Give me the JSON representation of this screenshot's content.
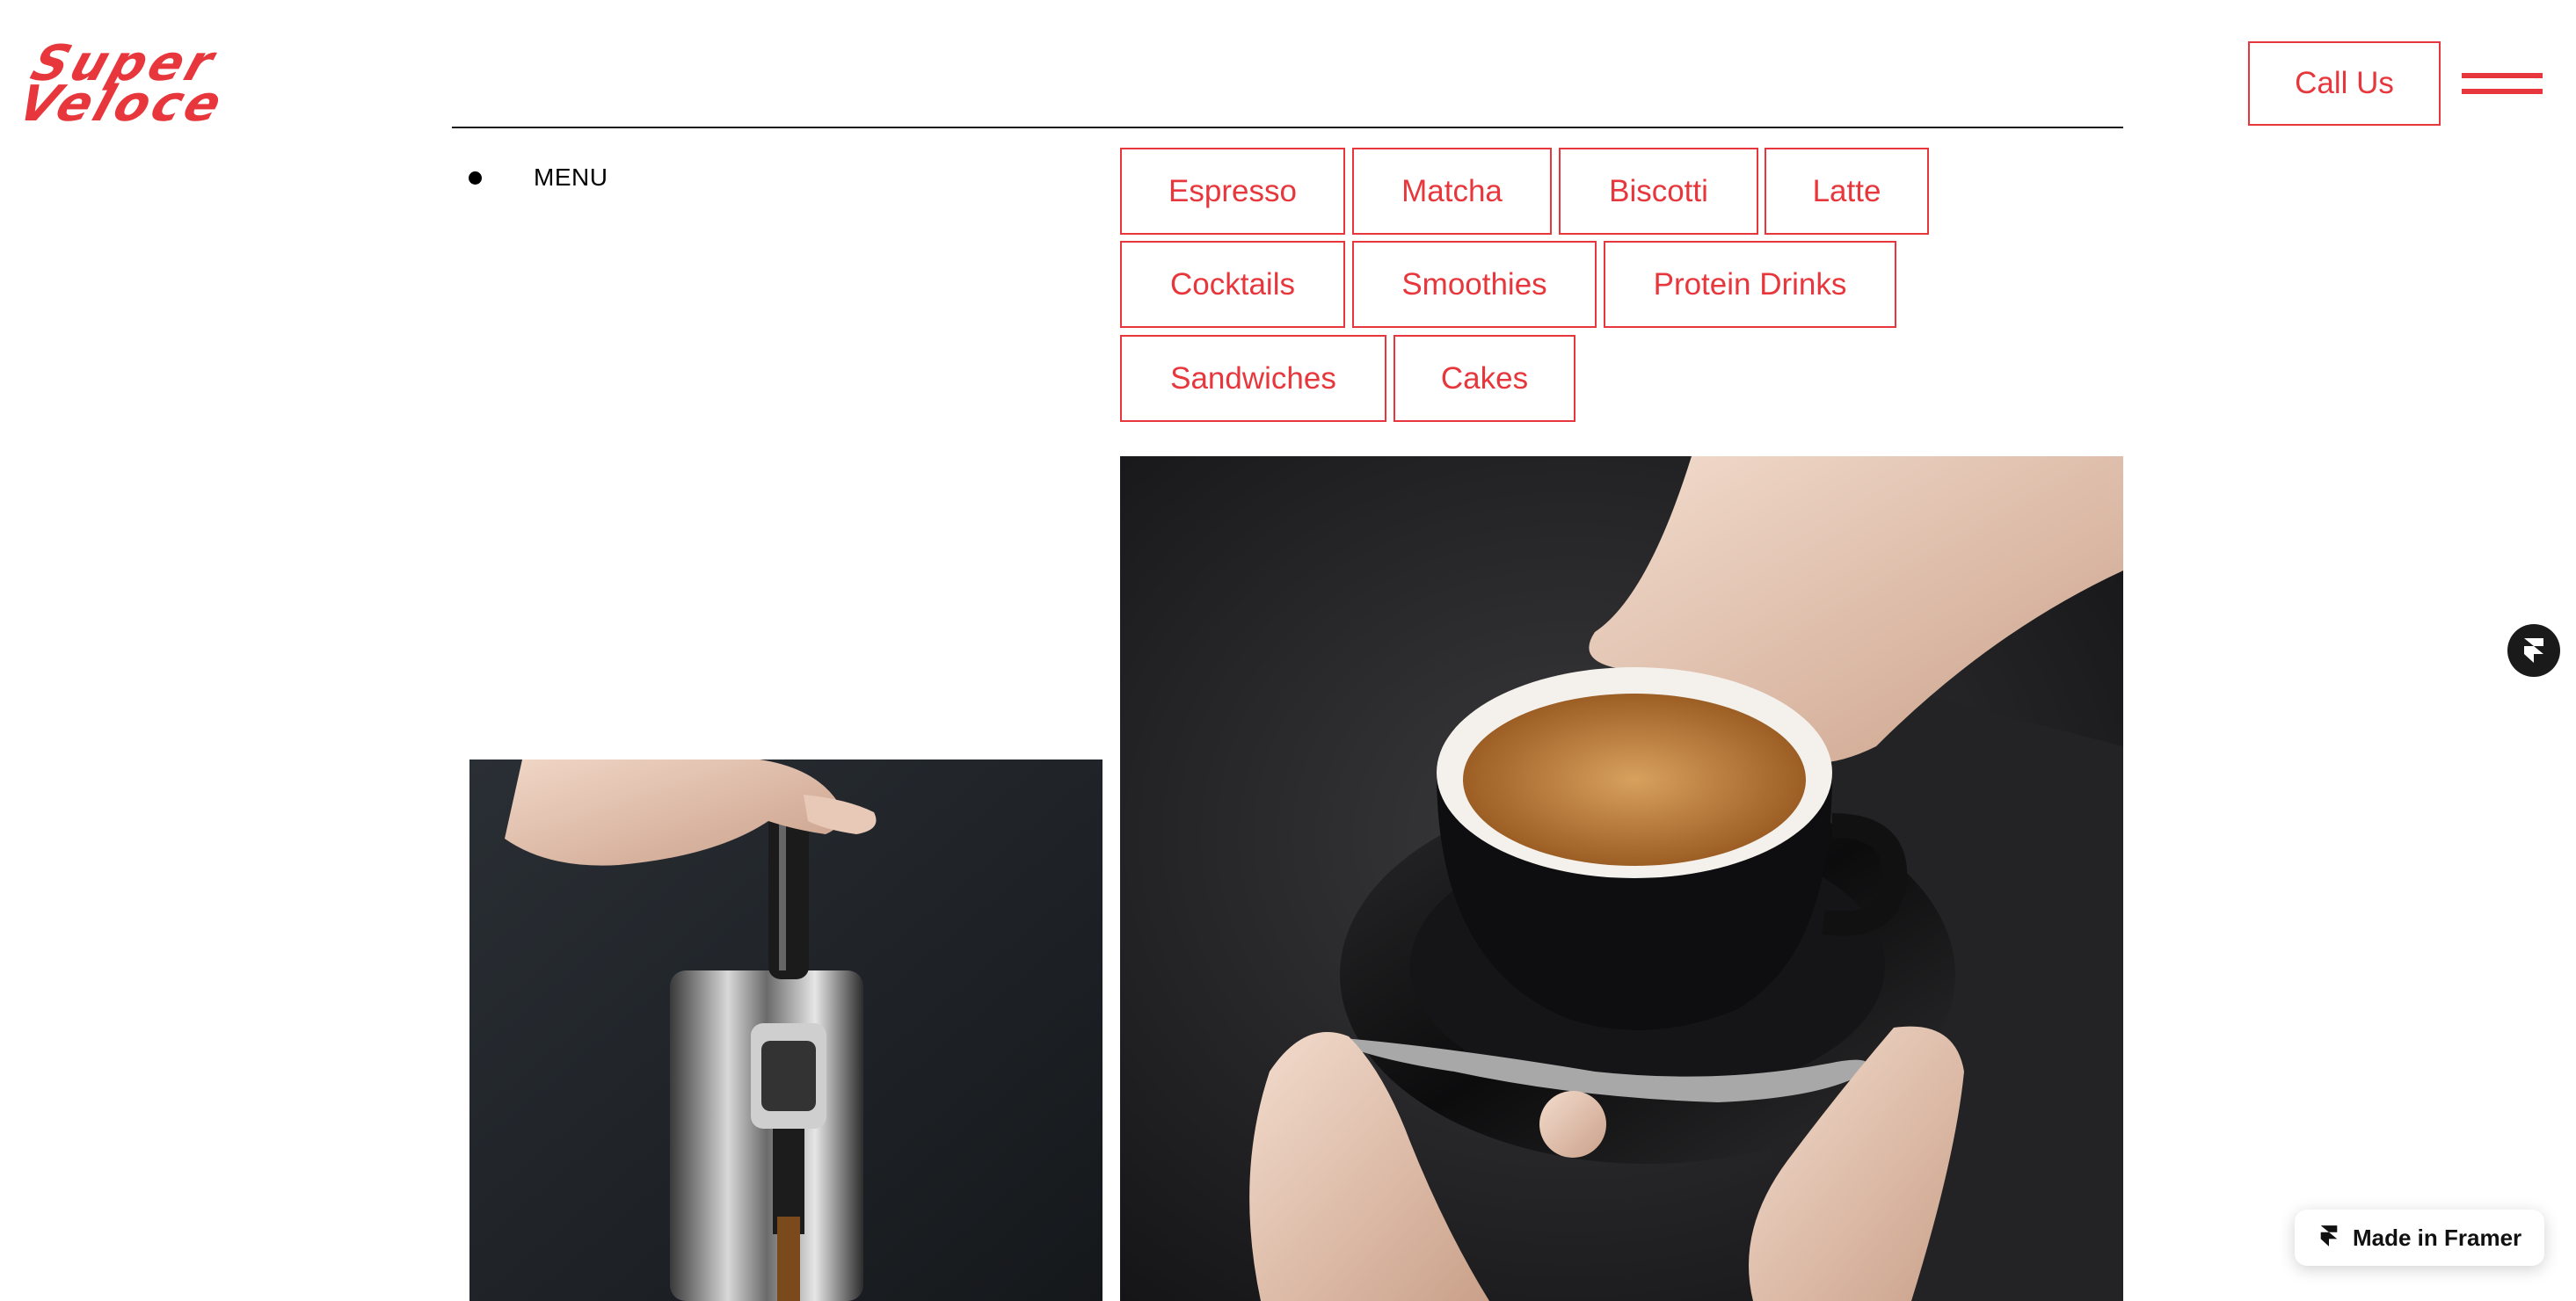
{
  "brand": {
    "line1": "Super",
    "line2": "Veloce",
    "accent_color": "#e8373c"
  },
  "header": {
    "call_label": "Call Us",
    "menu_icon": "hamburger-icon"
  },
  "menu": {
    "label": "MENU"
  },
  "categories": [
    "Espresso",
    "Matcha",
    "Biscotti",
    "Latte",
    "Cocktails",
    "Smoothies",
    "Protein Drinks",
    "Sandwiches",
    "Cakes"
  ],
  "framer": {
    "floating_icon": "framer-logo-icon",
    "badge_label": "Made in Framer"
  }
}
